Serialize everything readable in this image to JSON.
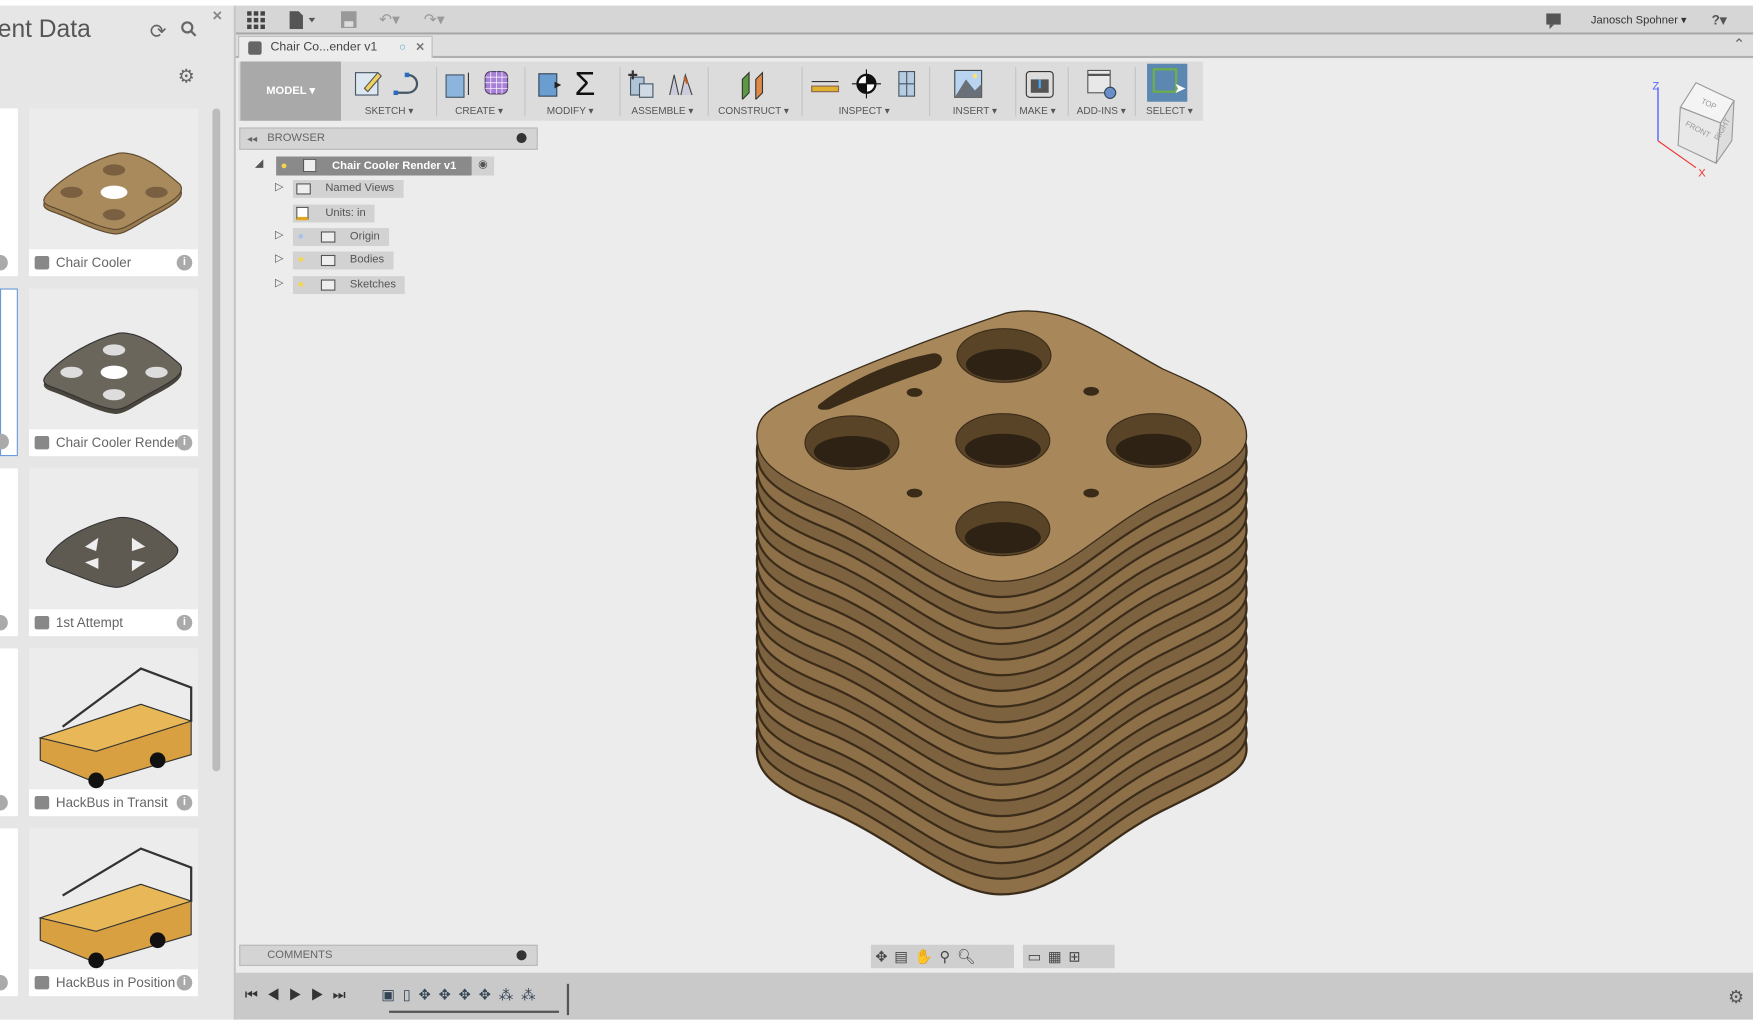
{
  "left_panel": {
    "title": "ent Data",
    "icons": [
      "refresh-icon",
      "search-icon",
      "close-icon",
      "gear-icon"
    ],
    "cards": [
      {
        "label": "Chair Cooler",
        "thumb": "wood-plate"
      },
      {
        "label": "Chair Cooler Render",
        "thumb": "gray-plate"
      },
      {
        "label": "1st Attempt",
        "thumb": "gray-triangle-plate"
      },
      {
        "label": "HackBus in Transit",
        "thumb": "yellow-bus"
      },
      {
        "label": "HackBus in Position",
        "thumb": "yellow-bus"
      }
    ]
  },
  "topbar": {
    "user": "Janosch Spohner ▾",
    "help": "?▾"
  },
  "tab": {
    "label": "Chair Co...ender v1"
  },
  "toolbar": {
    "workspace": "MODEL ▾",
    "groups": [
      {
        "label": "SKETCH ▾"
      },
      {
        "label": "CREATE ▾"
      },
      {
        "label": "MODIFY ▾"
      },
      {
        "label": "ASSEMBLE ▾"
      },
      {
        "label": "CONSTRUCT ▾"
      },
      {
        "label": "INSPECT ▾"
      },
      {
        "label": "INSERT ▾"
      },
      {
        "label": "MAKE ▾"
      },
      {
        "label": "ADD-INS ▾"
      },
      {
        "label": "SELECT ▾"
      }
    ],
    "active_color": "#5b87b0"
  },
  "browser": {
    "title": "BROWSER",
    "root": "Chair Cooler Render v1",
    "items": [
      {
        "label": "Named Views"
      },
      {
        "label": "Units: in"
      },
      {
        "label": "Origin"
      },
      {
        "label": "Bodies"
      },
      {
        "label": "Sketches"
      }
    ]
  },
  "viewcube": {
    "top": "TOP",
    "front": "FRONT",
    "right": "RIGHT",
    "z": "Z",
    "x": "X"
  },
  "comments": {
    "title": "COMMENTS"
  },
  "colors": {
    "wood_top": "#a8885a",
    "wood_side": "#7d6240",
    "edge": "#3b2c1a"
  }
}
